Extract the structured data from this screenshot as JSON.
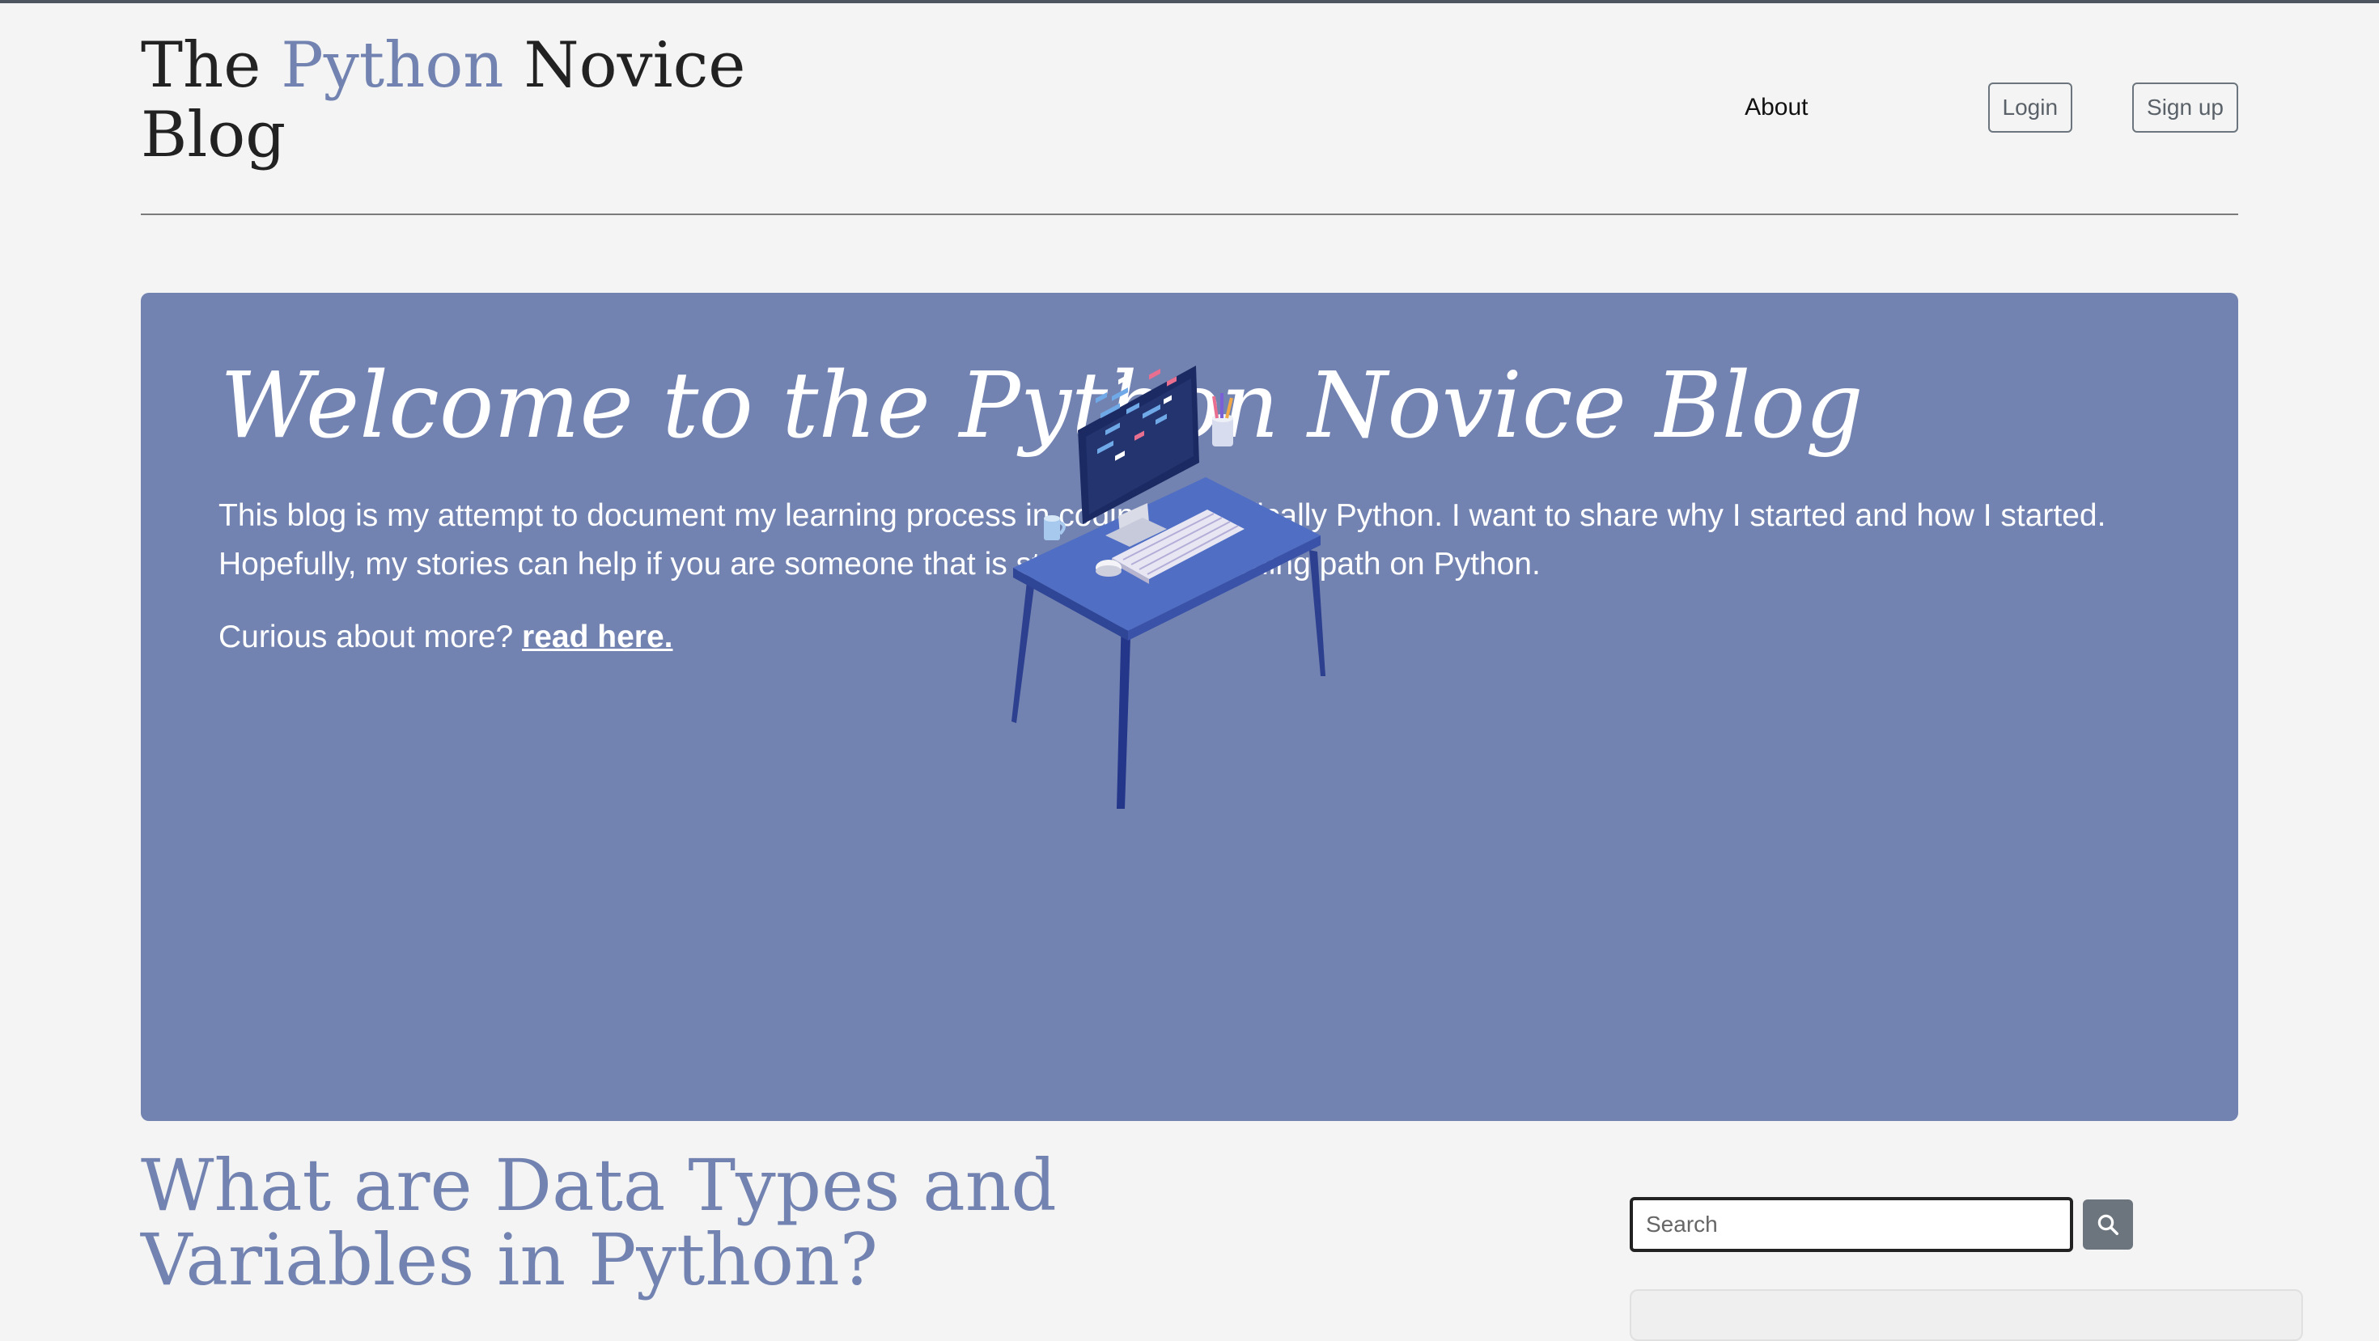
{
  "header": {
    "title_prefix": "The ",
    "title_accent": "Python",
    "title_suffix": " Novice Blog",
    "nav_about": "About",
    "login_label": "Login",
    "signup_label": "Sign up"
  },
  "hero": {
    "title": "Welcome to the Python Novice Blog",
    "description": "This blog is my attempt to document my learning process in coding. Specifically Python. I want to share why I started and how I started. Hopefully, my stories can help if you are someone that is starting your learning path on Python.",
    "more_prefix": "Curious about more? ",
    "more_link": "read here."
  },
  "post": {
    "title": "What are Data Types and Variables in Python?"
  },
  "sidebar": {
    "search_placeholder": "Search"
  },
  "colors": {
    "accent": "#7383b1",
    "background": "#f3f4f3",
    "button_gray": "#6c757d"
  },
  "icons": {
    "search": "search-icon",
    "illustration": "desk-computer-illustration"
  }
}
